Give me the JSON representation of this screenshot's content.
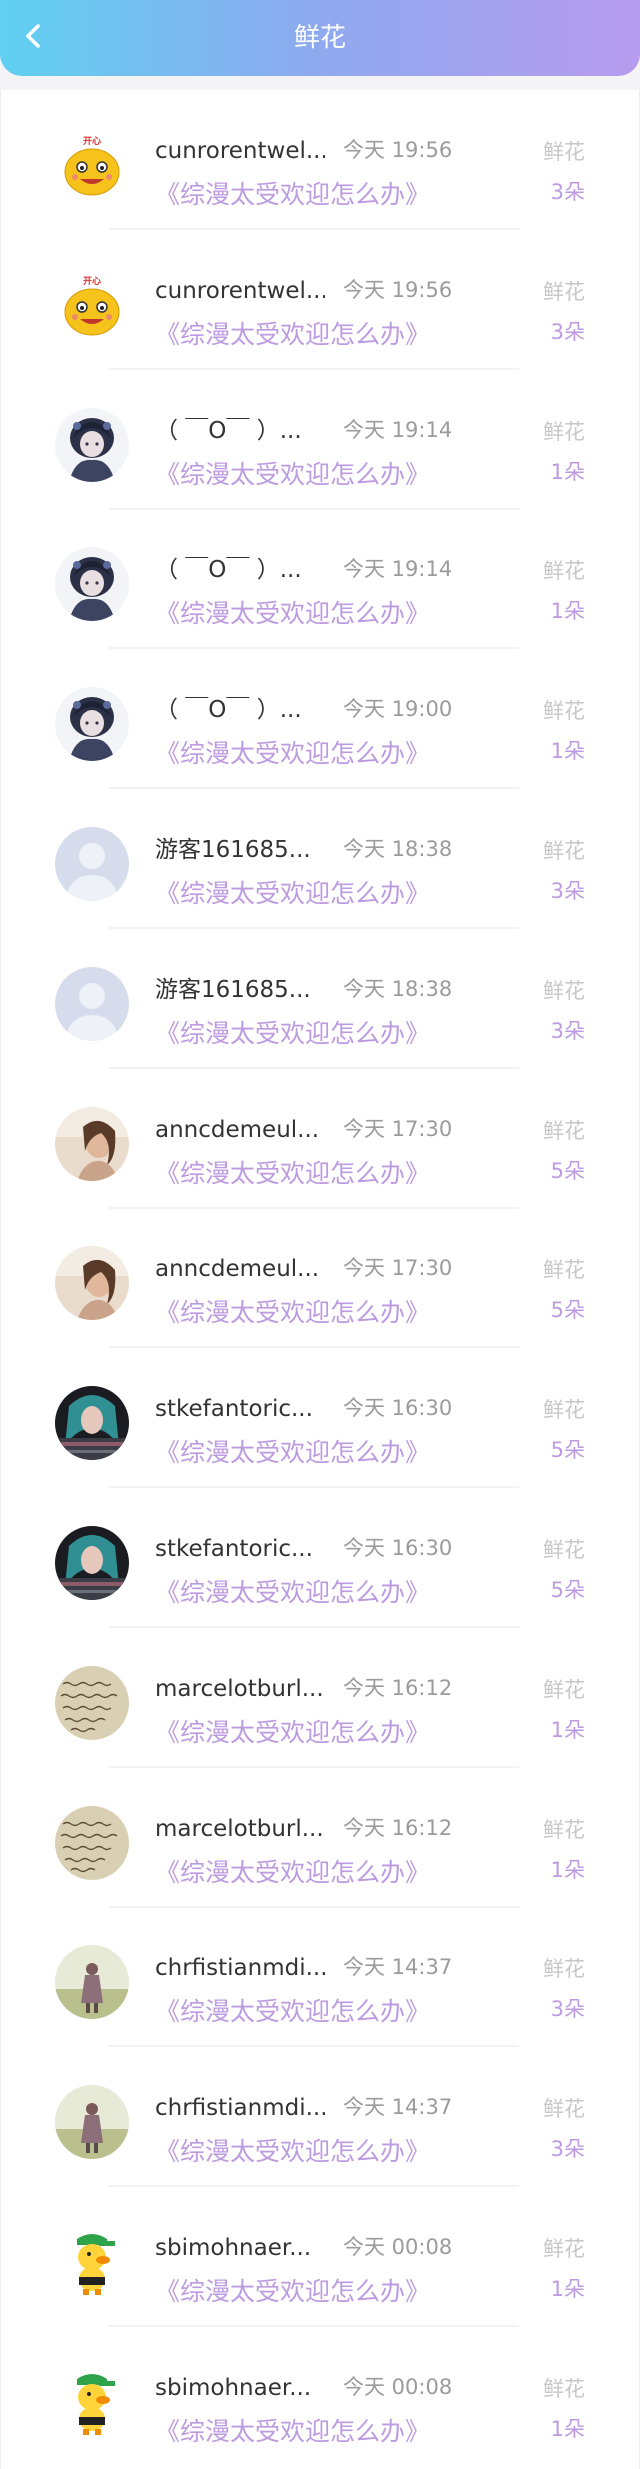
{
  "header": {
    "title": "鲜花",
    "back_icon": "chevron-left-icon",
    "gradient": [
      "#5fd0f1",
      "#b79cee"
    ]
  },
  "accent_color": "#bd9be0",
  "records": [
    {
      "username": "cunrorentwel...",
      "time": "今天 19:56",
      "book": "《综漫太受欢迎怎么办》",
      "gift_label": "鲜花",
      "count": "3朵",
      "avatar": "cartoon-face"
    },
    {
      "username": "cunrorentwel...",
      "time": "今天 19:56",
      "book": "《综漫太受欢迎怎么办》",
      "gift_label": "鲜花",
      "count": "3朵",
      "avatar": "cartoon-face"
    },
    {
      "username": "（ ￣O￣ ）...",
      "time": "今天 19:14",
      "book": "《综漫太受欢迎怎么办》",
      "gift_label": "鲜花",
      "count": "1朵",
      "avatar": "anime-dark"
    },
    {
      "username": "（ ￣O￣ ）...",
      "time": "今天 19:14",
      "book": "《综漫太受欢迎怎么办》",
      "gift_label": "鲜花",
      "count": "1朵",
      "avatar": "anime-dark"
    },
    {
      "username": "（ ￣O￣ ）...",
      "time": "今天 19:00",
      "book": "《综漫太受欢迎怎么办》",
      "gift_label": "鲜花",
      "count": "1朵",
      "avatar": "anime-dark"
    },
    {
      "username": "游客161685...",
      "time": "今天 18:38",
      "book": "《综漫太受欢迎怎么办》",
      "gift_label": "鲜花",
      "count": "3朵",
      "avatar": "default-user"
    },
    {
      "username": "游客161685...",
      "time": "今天 18:38",
      "book": "《综漫太受欢迎怎么办》",
      "gift_label": "鲜花",
      "count": "3朵",
      "avatar": "default-user"
    },
    {
      "username": "anncdemeul...",
      "time": "今天 17:30",
      "book": "《综漫太受欢迎怎么办》",
      "gift_label": "鲜花",
      "count": "5朵",
      "avatar": "photo-warm"
    },
    {
      "username": "anncdemeul...",
      "time": "今天 17:30",
      "book": "《综漫太受欢迎怎么办》",
      "gift_label": "鲜花",
      "count": "5朵",
      "avatar": "photo-warm"
    },
    {
      "username": "stkefantoric...",
      "time": "今天 16:30",
      "book": "《综漫太受欢迎怎么办》",
      "gift_label": "鲜花",
      "count": "5朵",
      "avatar": "photo-teal"
    },
    {
      "username": "stkefantoric...",
      "time": "今天 16:30",
      "book": "《综漫太受欢迎怎么办》",
      "gift_label": "鲜花",
      "count": "5朵",
      "avatar": "photo-teal"
    },
    {
      "username": "marcelotburl...",
      "time": "今天 16:12",
      "book": "《综漫太受欢迎怎么办》",
      "gift_label": "鲜花",
      "count": "1朵",
      "avatar": "handwriting"
    },
    {
      "username": "marcelotburl...",
      "time": "今天 16:12",
      "book": "《综漫太受欢迎怎么办》",
      "gift_label": "鲜花",
      "count": "1朵",
      "avatar": "handwriting"
    },
    {
      "username": "chrfistianmdi...",
      "time": "今天 14:37",
      "book": "《综漫太受欢迎怎么办》",
      "gift_label": "鲜花",
      "count": "3朵",
      "avatar": "photo-field"
    },
    {
      "username": "chrfistianmdi...",
      "time": "今天 14:37",
      "book": "《综漫太受欢迎怎么办》",
      "gift_label": "鲜花",
      "count": "3朵",
      "avatar": "photo-field"
    },
    {
      "username": "sbimohnaer...",
      "time": "今天 00:08",
      "book": "《综漫太受欢迎怎么办》",
      "gift_label": "鲜花",
      "count": "1朵",
      "avatar": "duck-cartoon"
    },
    {
      "username": "sbimohnaer...",
      "time": "今天 00:08",
      "book": "《综漫太受欢迎怎么办》",
      "gift_label": "鲜花",
      "count": "1朵",
      "avatar": "duck-cartoon"
    }
  ]
}
